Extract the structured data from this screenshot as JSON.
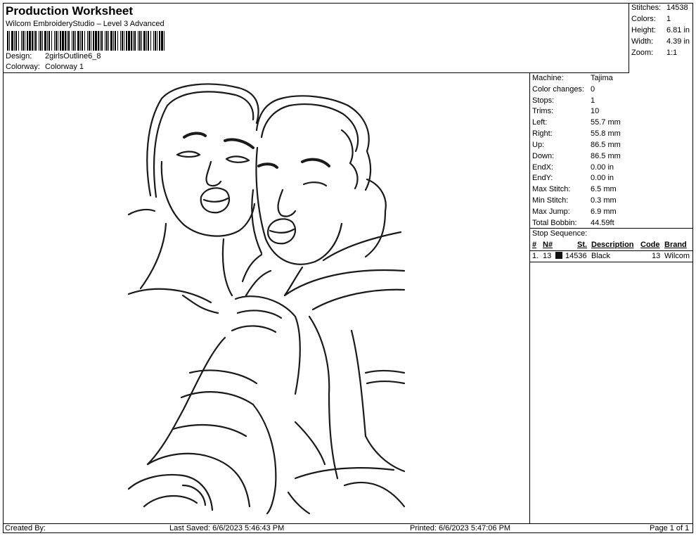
{
  "header": {
    "title": "Production Worksheet",
    "subtitle": "Wilcom EmbroideryStudio – Level 3 Advanced",
    "design_label": "Design:",
    "design_value": "2girlsOutline6_8",
    "colorway_label": "Colorway:",
    "colorway_value": "Colorway 1"
  },
  "summary": [
    {
      "label": "Stitches:",
      "value": "14538"
    },
    {
      "label": "Colors:",
      "value": "1"
    },
    {
      "label": "Height:",
      "value": "6.81 in"
    },
    {
      "label": "Width:",
      "value": "4.39 in"
    },
    {
      "label": "Zoom:",
      "value": "1:1"
    }
  ],
  "machine_info": [
    {
      "label": "Machine:",
      "value": "Tajima"
    },
    {
      "label": "Color changes:",
      "value": "0"
    },
    {
      "label": "Stops:",
      "value": "1"
    },
    {
      "label": "Trims:",
      "value": "10"
    },
    {
      "label": "Left:",
      "value": "55.7 mm"
    },
    {
      "label": "Right:",
      "value": "55.8 mm"
    },
    {
      "label": "Up:",
      "value": "86.5 mm"
    },
    {
      "label": "Down:",
      "value": "86.5 mm"
    },
    {
      "label": "EndX:",
      "value": "0.00 in"
    },
    {
      "label": "EndY:",
      "value": "0.00 in"
    },
    {
      "label": "Max Stitch:",
      "value": "6.5 mm"
    },
    {
      "label": "Min Stitch:",
      "value": "0.3 mm"
    },
    {
      "label": "Max Jump:",
      "value": "6.9 mm"
    },
    {
      "label": "Total Bobbin:",
      "value": "44.59ft"
    }
  ],
  "stop_sequence": {
    "title": "Stop Sequence:",
    "columns": [
      "#",
      "N#",
      "St.",
      "Description",
      "Code",
      "Brand"
    ],
    "rows": [
      {
        "num": "1.",
        "n": "13",
        "color": "#111111",
        "st": "14536",
        "description": "Black",
        "code": "13",
        "brand": "Wilcom"
      }
    ]
  },
  "footer": {
    "created_by": "Created By:",
    "last_saved": "Last Saved: 6/6/2023 5:46:43 PM",
    "printed": "Printed: 6/6/2023 5:47:06 PM",
    "page": "Page 1 of 1"
  },
  "colors": {
    "thread": "#1a1a1a"
  }
}
